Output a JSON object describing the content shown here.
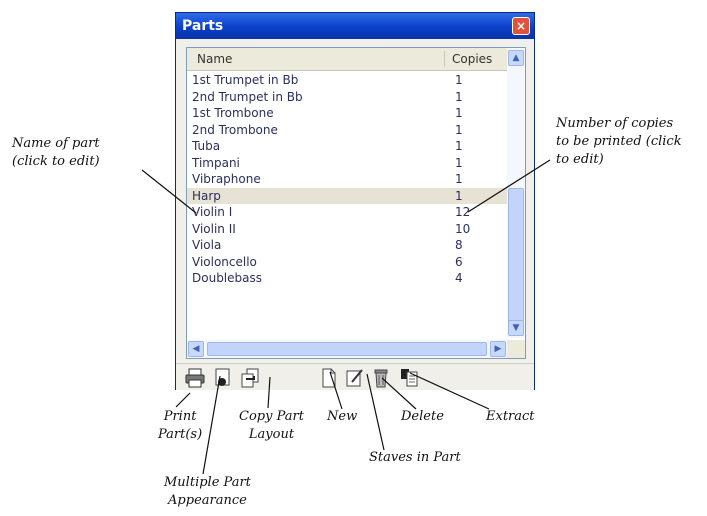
{
  "window": {
    "title": "Parts",
    "close_glyph": "×"
  },
  "table": {
    "headers": {
      "name": "Name",
      "copies": "Copies"
    },
    "rows": [
      {
        "name": "1st Trumpet in Bb",
        "copies": "1"
      },
      {
        "name": "2nd Trumpet in Bb",
        "copies": "1"
      },
      {
        "name": "1st Trombone",
        "copies": "1"
      },
      {
        "name": "2nd Trombone",
        "copies": "1"
      },
      {
        "name": "Tuba",
        "copies": "1"
      },
      {
        "name": "Timpani",
        "copies": "1"
      },
      {
        "name": "Vibraphone",
        "copies": "1"
      },
      {
        "name": "Harp",
        "copies": "1",
        "selected": true
      },
      {
        "name": "Violin I",
        "copies": "12"
      },
      {
        "name": "Violin II",
        "copies": "10"
      },
      {
        "name": "Viola",
        "copies": "8"
      },
      {
        "name": "Violoncello",
        "copies": "6"
      },
      {
        "name": "Doublebass",
        "copies": "4"
      }
    ]
  },
  "toolbar_icons": [
    "print-icon",
    "multiple-part-appearance-icon",
    "copy-part-layout-icon",
    "new-part-icon",
    "staves-in-part-icon",
    "delete-icon",
    "extract-icon"
  ],
  "callouts": {
    "name_of_part": [
      "Name of part",
      "(click to edit)"
    ],
    "number_of_copies": [
      "Number of copies",
      "to be printed (click",
      "to edit)"
    ],
    "print_parts": [
      "Print",
      "Part(s)"
    ],
    "multiple_part_appearance": [
      "Multiple Part",
      "Appearance"
    ],
    "copy_part_layout": [
      "Copy Part",
      "Layout"
    ],
    "new": "New",
    "staves_in_part": "Staves in Part",
    "delete": "Delete",
    "extract": "Extract"
  }
}
